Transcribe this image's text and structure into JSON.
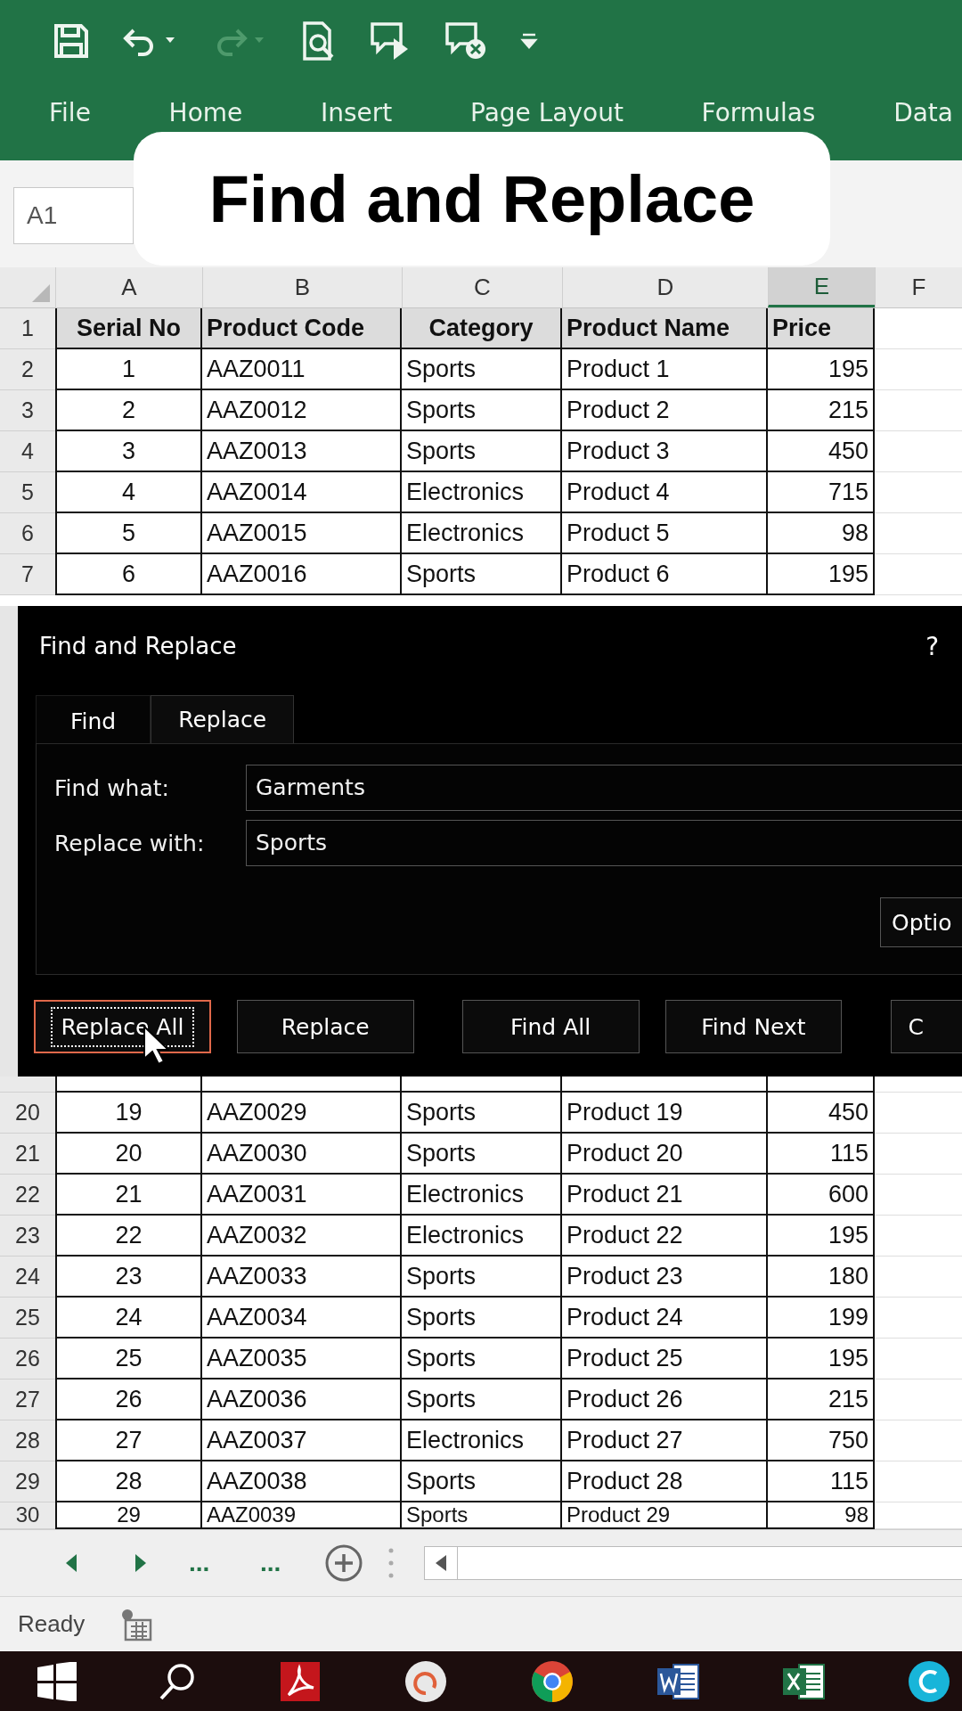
{
  "quick_access": [
    {
      "kind": "save",
      "disabled": false
    },
    {
      "kind": "undo",
      "disabled": false
    },
    {
      "kind": "redo",
      "disabled": true
    },
    {
      "kind": "preview",
      "disabled": false
    },
    {
      "kind": "comment-next",
      "disabled": false
    },
    {
      "kind": "comment-delete",
      "disabled": false
    },
    {
      "kind": "customize",
      "disabled": false
    }
  ],
  "ribbon_tabs": [
    "File",
    "Home",
    "Insert",
    "Page Layout",
    "Formulas",
    "Data"
  ],
  "name_box": {
    "value": "A1"
  },
  "overlay_title": "Find and Replace",
  "sheet": {
    "column_headers": [
      {
        "label": "A",
        "selected": false
      },
      {
        "label": "B",
        "selected": false
      },
      {
        "label": "C",
        "selected": false
      },
      {
        "label": "D",
        "selected": false
      },
      {
        "label": "E",
        "selected": true
      },
      {
        "label": "F",
        "selected": false
      }
    ],
    "header_row": {
      "number": "1",
      "cells": [
        "Serial No",
        "Product Code",
        "Category",
        "Product Name",
        "Price"
      ]
    },
    "rows_above": [
      {
        "number": "2",
        "cells": [
          "1",
          "AAZ0011",
          "Sports",
          "Product 1",
          "195"
        ]
      },
      {
        "number": "3",
        "cells": [
          "2",
          "AAZ0012",
          "Sports",
          "Product 2",
          "215"
        ]
      },
      {
        "number": "4",
        "cells": [
          "3",
          "AAZ0013",
          "Sports",
          "Product 3",
          "450"
        ]
      },
      {
        "number": "5",
        "cells": [
          "4",
          "AAZ0014",
          "Electronics",
          "Product 4",
          "715"
        ]
      },
      {
        "number": "6",
        "cells": [
          "5",
          "AAZ0015",
          "Electronics",
          "Product 5",
          "98"
        ]
      },
      {
        "number": "7",
        "cells": [
          "6",
          "AAZ0016",
          "Sports",
          "Product 6",
          "195"
        ]
      }
    ],
    "rows_below": [
      {
        "number": "20",
        "cells": [
          "19",
          "AAZ0029",
          "Sports",
          "Product 19",
          "450"
        ]
      },
      {
        "number": "21",
        "cells": [
          "20",
          "AAZ0030",
          "Sports",
          "Product 20",
          "115"
        ]
      },
      {
        "number": "22",
        "cells": [
          "21",
          "AAZ0031",
          "Electronics",
          "Product 21",
          "600"
        ]
      },
      {
        "number": "23",
        "cells": [
          "22",
          "AAZ0032",
          "Electronics",
          "Product 22",
          "195"
        ]
      },
      {
        "number": "24",
        "cells": [
          "23",
          "AAZ0033",
          "Sports",
          "Product 23",
          "180"
        ]
      },
      {
        "number": "25",
        "cells": [
          "24",
          "AAZ0034",
          "Sports",
          "Product 24",
          "199"
        ]
      },
      {
        "number": "26",
        "cells": [
          "25",
          "AAZ0035",
          "Sports",
          "Product 25",
          "195"
        ]
      },
      {
        "number": "27",
        "cells": [
          "26",
          "AAZ0036",
          "Sports",
          "Product 26",
          "215"
        ]
      },
      {
        "number": "28",
        "cells": [
          "27",
          "AAZ0037",
          "Electronics",
          "Product 27",
          "750"
        ]
      },
      {
        "number": "29",
        "cells": [
          "28",
          "AAZ0038",
          "Sports",
          "Product 28",
          "115"
        ]
      },
      {
        "number": "30",
        "cells": [
          "29",
          "AAZ0039",
          "Sports",
          "Product 29",
          "98"
        ]
      }
    ]
  },
  "dialog": {
    "title": "Find and Replace",
    "help": "?",
    "tabs": [
      {
        "label": "Find",
        "selected": false
      },
      {
        "label": "Replace",
        "selected": true
      }
    ],
    "fields": [
      {
        "label": "Find what:",
        "value": "Garments"
      },
      {
        "label": "Replace with:",
        "value": "Sports"
      }
    ],
    "options_button": "Optio",
    "buttons": [
      {
        "label": "Replace All",
        "focused": true
      },
      {
        "label": "Replace",
        "focused": false
      },
      {
        "label": "Find All",
        "focused": false
      },
      {
        "label": "Find Next",
        "focused": false
      },
      {
        "label": "C",
        "focused": false
      }
    ]
  },
  "sheet_tabs_bar": {
    "ellipses": [
      "...",
      "..."
    ]
  },
  "status_bar": {
    "text": "Ready"
  }
}
